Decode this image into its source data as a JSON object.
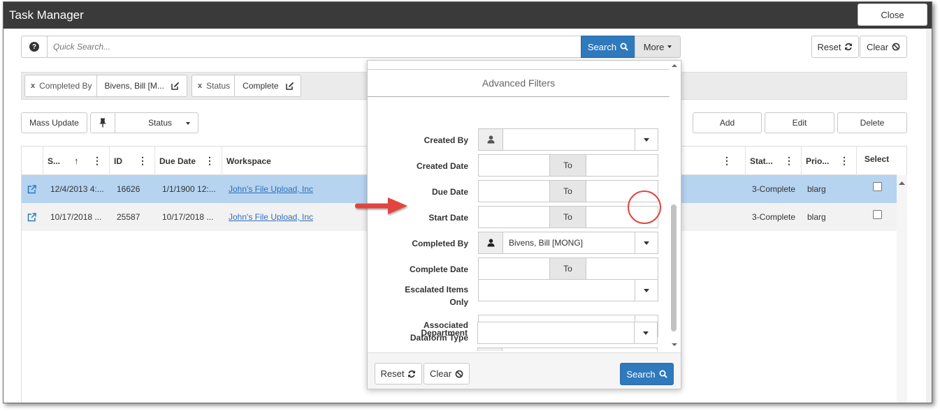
{
  "window": {
    "title": "Task Manager",
    "close_label": "Close"
  },
  "toolbar": {
    "quick_search_placeholder": "Quick Search...",
    "search_label": "Search",
    "more_label": "More",
    "reset_label": "Reset",
    "clear_label": "Clear"
  },
  "active_filters": [
    {
      "label": "Completed By",
      "value": "Bivens, Bill [M..."
    },
    {
      "label": "Status",
      "value": "Complete"
    }
  ],
  "actions": {
    "mass_update_label": "Mass Update",
    "status_label": "Status",
    "add_label": "Add",
    "edit_label": "Edit",
    "delete_label": "Delete"
  },
  "grid": {
    "columns": [
      "S...",
      "ID",
      "Due Date",
      "Workspace",
      "Stat...",
      "Prio...",
      "Select"
    ],
    "rows": [
      {
        "start": "12/4/2013 4:...",
        "id": "16626",
        "due": "1/1/1900 12:...",
        "workspace": "John's File Upload, Inc",
        "status": "3-Complete",
        "priority": "blarg",
        "selected": true
      },
      {
        "start": "10/17/2018 ...",
        "id": "25587",
        "due": "10/17/2018 ...",
        "workspace": "John's File Upload, Inc",
        "status": "3-Complete",
        "priority": "blarg",
        "selected": false
      }
    ]
  },
  "advanced_filters": {
    "title": "Advanced Filters",
    "to_label": "To",
    "fields": {
      "created_by": "Created By",
      "created_date": "Created Date",
      "due_date": "Due Date",
      "start_date": "Start Date",
      "completed_by": "Completed By",
      "completed_by_value": "Bivens, Bill [MONG]",
      "complete_date": "Complete Date",
      "escalated_line1": "Escalated Items",
      "escalated_line2": "Only",
      "assoc_line1": "Associated",
      "assoc_line2": "Dataform Type",
      "department": "Department"
    },
    "footer": {
      "reset_label": "Reset",
      "clear_label": "Clear",
      "search_label": "Search"
    }
  },
  "colors": {
    "accent": "#2f79bd",
    "selected_row": "#b6d3f0",
    "annotation": "#e2453c",
    "titlebar": "#3a3a3a"
  }
}
